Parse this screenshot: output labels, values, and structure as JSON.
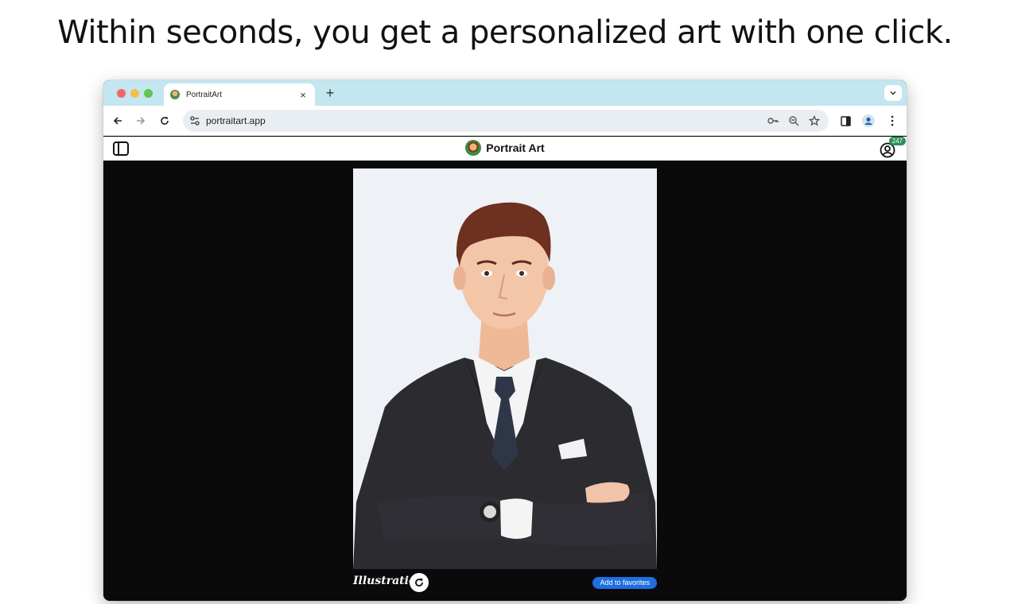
{
  "headline": "Within seconds, you get a personalized art with one click.",
  "browser": {
    "tab": {
      "title": "PortraitArt",
      "close": "×"
    },
    "new_tab": "+",
    "url": "portraitart.app",
    "icons": [
      "back-icon",
      "forward-icon",
      "reload-icon",
      "site-settings-icon",
      "key-icon",
      "zoom-icon",
      "star-icon",
      "side-panel-icon",
      "profile-icon",
      "menu-icon",
      "tab-search-icon"
    ]
  },
  "app": {
    "brand": "Portrait Art",
    "account_badge": "247"
  },
  "viewer": {
    "style_label": "Illustration",
    "favorite_button": "Add to favorites"
  },
  "colors": {
    "tabstrip": "#c3e6f0",
    "content_bg": "#0b0a0a",
    "favorite_button": "#1f6fe0",
    "badge": "#2f8f5b"
  }
}
